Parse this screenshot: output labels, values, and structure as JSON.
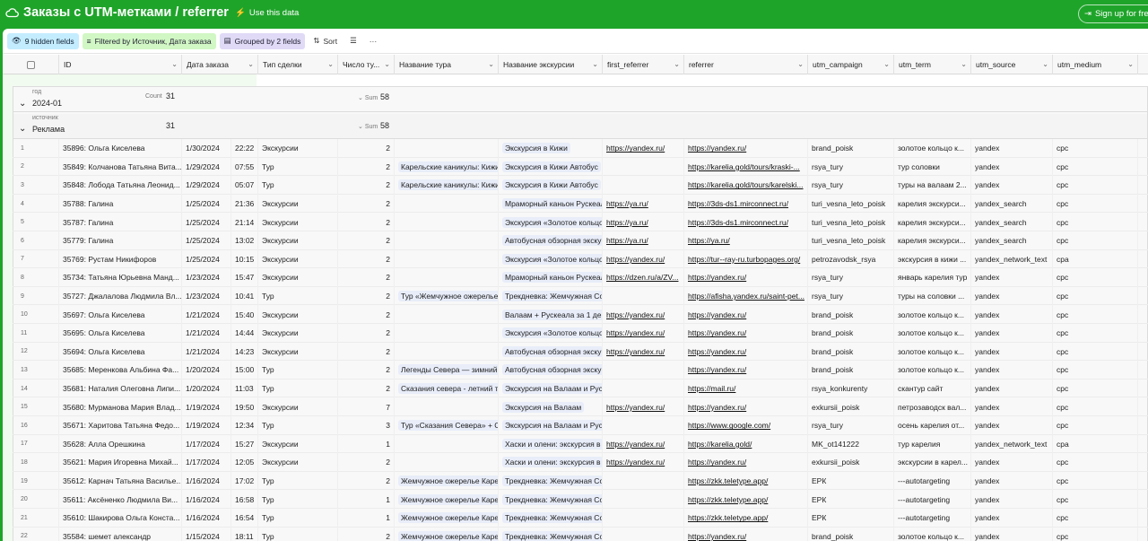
{
  "app": {
    "title": "Заказы с UTM-метками / referrer",
    "use_label": "Use this data",
    "signup_label": "Sign up for free"
  },
  "toolbar": {
    "hidden": "9 hidden fields",
    "filter": "Filtered by Источник, Дата заказа",
    "group": "Grouped by 2 fields",
    "sort": "Sort"
  },
  "columns": [
    "ID",
    "Дата заказа",
    "Тип сделки",
    "Число ту...",
    "Название тура",
    "Название экскурсии",
    "first_referrer",
    "referrer",
    "utm_campaign",
    "utm_term",
    "utm_source",
    "utm_medium"
  ],
  "group1": {
    "label": "год",
    "value": "2024-01",
    "count_label": "Count",
    "count": "31",
    "sum_label": "Sum",
    "sum": "58"
  },
  "group2": {
    "label": "источник",
    "value": "Реклама",
    "count": "31",
    "sum_label": "Sum",
    "sum": "58"
  },
  "rows": [
    {
      "n": "1",
      "id": "35896: Ольга Киселева",
      "date": "1/30/2024",
      "time": "22:22",
      "type": "Экскурсии",
      "qty": "2",
      "tour": "",
      "exc": "Экскурсия в Кижи",
      "fr": "https://yandex.ru/",
      "ref": "https://yandex.ru/",
      "camp": "brand_poisk",
      "term": "золотое кольцо к...",
      "src": "yandex",
      "med": "cpc"
    },
    {
      "n": "2",
      "id": "35849: Колчанова Татьяна Вита...",
      "date": "1/29/2024",
      "time": "07:55",
      "type": "Тур",
      "qty": "2",
      "tour": "Карельские каникулы: Кижи",
      "exc": "Экскурсия в Кижи   Автобус",
      "fr": "",
      "ref": "https://karelia.gold/tours/kraski-...",
      "camp": "rsya_tury",
      "term": "тур соловки",
      "src": "yandex",
      "med": "cpc"
    },
    {
      "n": "3",
      "id": "35848: Лобода Татьяна Леонид...",
      "date": "1/29/2024",
      "time": "05:07",
      "type": "Тур",
      "qty": "2",
      "tour": "Карельские каникулы: Кижи",
      "exc": "Экскурсия в Кижи   Автобус",
      "fr": "",
      "ref": "https://karelia.gold/tours/karelski...",
      "camp": "rsya_tury",
      "term": "туры на валаам 2...",
      "src": "yandex",
      "med": "cpc"
    },
    {
      "n": "4",
      "id": "35788: Галина",
      "date": "1/25/2024",
      "time": "21:36",
      "type": "Экскурсии",
      "qty": "2",
      "tour": "",
      "exc": "Мраморный каньон Рускеал",
      "fr": "https://ya.ru/",
      "ref": "https://3ds-ds1.mirconnect.ru/",
      "camp": "turi_vesna_leto_poisk",
      "term": "карелия экскурси...",
      "src": "yandex_search",
      "med": "cpc"
    },
    {
      "n": "5",
      "id": "35787: Галина",
      "date": "1/25/2024",
      "time": "21:14",
      "type": "Экскурсии",
      "qty": "2",
      "tour": "",
      "exc": "Экскурсия «Золотое кольцо",
      "fr": "https://ya.ru/",
      "ref": "https://3ds-ds1.mirconnect.ru/",
      "camp": "turi_vesna_leto_poisk",
      "term": "карелия экскурси...",
      "src": "yandex_search",
      "med": "cpc"
    },
    {
      "n": "6",
      "id": "35779: Галина",
      "date": "1/25/2024",
      "time": "13:02",
      "type": "Экскурсии",
      "qty": "2",
      "tour": "",
      "exc": "Автобусная обзорная экску",
      "fr": "https://ya.ru/",
      "ref": "https://ya.ru/",
      "camp": "turi_vesna_leto_poisk",
      "term": "карелия экскурси...",
      "src": "yandex_search",
      "med": "cpc"
    },
    {
      "n": "7",
      "id": "35769: Рустам Никифоров",
      "date": "1/25/2024",
      "time": "10:15",
      "type": "Экскурсии",
      "qty": "2",
      "tour": "",
      "exc": "Экскурсия «Золотое кольцо",
      "fr": "https://yandex.ru/",
      "ref": "https://tur--ray-ru.turbopages.org/",
      "camp": "petrozavodsk_rsya",
      "term": "экскурсия в кижи ...",
      "src": "yandex_network_text",
      "med": "cpa"
    },
    {
      "n": "8",
      "id": "35734: Татьяна Юрьевна Манд...",
      "date": "1/23/2024",
      "time": "15:47",
      "type": "Экскурсии",
      "qty": "2",
      "tour": "",
      "exc": "Мраморный каньон Рускеал",
      "fr": "https://dzen.ru/a/ZV...",
      "ref": "https://yandex.ru/",
      "camp": "rsya_tury",
      "term": "январь карелия тур",
      "src": "yandex",
      "med": "cpc"
    },
    {
      "n": "9",
      "id": "35727: Джалалова Людмила Вл...",
      "date": "1/23/2024",
      "time": "10:41",
      "type": "Тур",
      "qty": "2",
      "tour": "Тур «Жемчужное ожерелье",
      "exc": "Трекдневка: Жемчужная Со",
      "fr": "",
      "ref": "https://afisha.yandex.ru/saint-pet...",
      "camp": "rsya_tury",
      "term": "туры на соловки ...",
      "src": "yandex",
      "med": "cpc"
    },
    {
      "n": "10",
      "id": "35697: Ольга Киселева",
      "date": "1/21/2024",
      "time": "15:40",
      "type": "Экскурсии",
      "qty": "2",
      "tour": "",
      "exc": "Валаам + Рускеала за 1 ден",
      "fr": "https://yandex.ru/",
      "ref": "https://yandex.ru/",
      "camp": "brand_poisk",
      "term": "золотое кольцо к...",
      "src": "yandex",
      "med": "cpc"
    },
    {
      "n": "11",
      "id": "35695: Ольга Киселева",
      "date": "1/21/2024",
      "time": "14:44",
      "type": "Экскурсии",
      "qty": "2",
      "tour": "",
      "exc": "Экскурсия «Золотое кольцо",
      "fr": "https://yandex.ru/",
      "ref": "https://yandex.ru/",
      "camp": "brand_poisk",
      "term": "золотое кольцо к...",
      "src": "yandex",
      "med": "cpc"
    },
    {
      "n": "12",
      "id": "35694: Ольга Киселева",
      "date": "1/21/2024",
      "time": "14:23",
      "type": "Экскурсии",
      "qty": "2",
      "tour": "",
      "exc": "Автобусная обзорная экску",
      "fr": "https://yandex.ru/",
      "ref": "https://yandex.ru/",
      "camp": "brand_poisk",
      "term": "золотое кольцо к...",
      "src": "yandex",
      "med": "cpc"
    },
    {
      "n": "13",
      "id": "35685: Меренкова Альбина Фа...",
      "date": "1/20/2024",
      "time": "15:00",
      "type": "Тур",
      "qty": "2",
      "tour": "Легенды Севера — зимний",
      "exc": "Автобусная обзорная экску",
      "fr": "",
      "ref": "https://yandex.ru/",
      "camp": "brand_poisk",
      "term": "золотое кольцо к...",
      "src": "yandex",
      "med": "cpc"
    },
    {
      "n": "14",
      "id": "35681: Наталия Олеговна Липи...",
      "date": "1/20/2024",
      "time": "11:03",
      "type": "Тур",
      "qty": "2",
      "tour": "Сказания севера - летний ту",
      "exc": "Экскурсия на Валаам и Руск",
      "fr": "",
      "ref": "https://mail.ru/",
      "camp": "rsya_konkurenty",
      "term": "скантур сайт",
      "src": "yandex",
      "med": "cpc"
    },
    {
      "n": "15",
      "id": "35680: Мурманова Мария Влад...",
      "date": "1/19/2024",
      "time": "19:50",
      "type": "Экскурсии",
      "qty": "7",
      "tour": "",
      "exc": "Экскурсия на Валаам",
      "fr": "https://yandex.ru/",
      "ref": "https://yandex.ru/",
      "camp": "exkursii_poisk",
      "term": "петрозаводск вал...",
      "src": "yandex",
      "med": "cpc"
    },
    {
      "n": "16",
      "id": "35671: Харитова Татьяна Федо...",
      "date": "1/19/2024",
      "time": "12:34",
      "type": "Тур",
      "qty": "3",
      "tour": "Тур «Сказания Севера» + Со",
      "exc": "Экскурсия на Валаам и Руск",
      "fr": "",
      "ref": "https://www.google.com/",
      "camp": "rsya_tury",
      "term": "осень карелия от...",
      "src": "yandex",
      "med": "cpc"
    },
    {
      "n": "17",
      "id": "35628: Алла Орешкина",
      "date": "1/17/2024",
      "time": "15:27",
      "type": "Экскурсии",
      "qty": "1",
      "tour": "",
      "exc": "Хаски и олени: экскурсия в",
      "fr": "https://yandex.ru/",
      "ref": "https://karelia.gold/",
      "camp": "MK_ot141222",
      "term": "тур карелия",
      "src": "yandex_network_text",
      "med": "cpa"
    },
    {
      "n": "18",
      "id": "35621: Мария Игоревна Михай...",
      "date": "1/17/2024",
      "time": "12:05",
      "type": "Экскурсии",
      "qty": "2",
      "tour": "",
      "exc": "Хаски и олени: экскурсия в",
      "fr": "https://yandex.ru/",
      "ref": "https://yandex.ru/",
      "camp": "exkursii_poisk",
      "term": "экскурсии в карел...",
      "src": "yandex",
      "med": "cpc"
    },
    {
      "n": "19",
      "id": "35612: Карнач Татьяна Василье...",
      "date": "1/16/2024",
      "time": "17:02",
      "type": "Тур",
      "qty": "2",
      "tour": "Жемчужное ожерелье Каре",
      "exc": "Трекдневка: Жемчужная Со",
      "fr": "",
      "ref": "https://zkk.teletype.app/",
      "camp": "ЕРК",
      "term": "---autotargeting",
      "src": "yandex",
      "med": "cpc"
    },
    {
      "n": "20",
      "id": "35611: Аксёненко Людмила Ви...",
      "date": "1/16/2024",
      "time": "16:58",
      "type": "Тур",
      "qty": "1",
      "tour": "Жемчужное ожерелье Каре",
      "exc": "Трекдневка: Жемчужная Со",
      "fr": "",
      "ref": "https://zkk.teletype.app/",
      "camp": "ЕРК",
      "term": "---autotargeting",
      "src": "yandex",
      "med": "cpc"
    },
    {
      "n": "21",
      "id": "35610: Шакирова Ольга Конста...",
      "date": "1/16/2024",
      "time": "16:54",
      "type": "Тур",
      "qty": "1",
      "tour": "Жемчужное ожерелье Каре",
      "exc": "Трекдневка: Жемчужная Со",
      "fr": "",
      "ref": "https://zkk.teletype.app/",
      "camp": "ЕРК",
      "term": "---autotargeting",
      "src": "yandex",
      "med": "cpc"
    },
    {
      "n": "22",
      "id": "35584: шемет александр",
      "date": "1/15/2024",
      "time": "18:11",
      "type": "Тур",
      "qty": "2",
      "tour": "Жемчужное ожерелье Каре",
      "exc": "Трекдневка: Жемчужная Со",
      "fr": "",
      "ref": "https://yandex.ru/",
      "camp": "brand_poisk",
      "term": "золотое кольцо к...",
      "src": "yandex",
      "med": "cpc"
    }
  ],
  "colors": {
    "brand": "#1fa42a",
    "frozen_bg": "#f1fbef",
    "tag_bg": "#e8edf9"
  }
}
